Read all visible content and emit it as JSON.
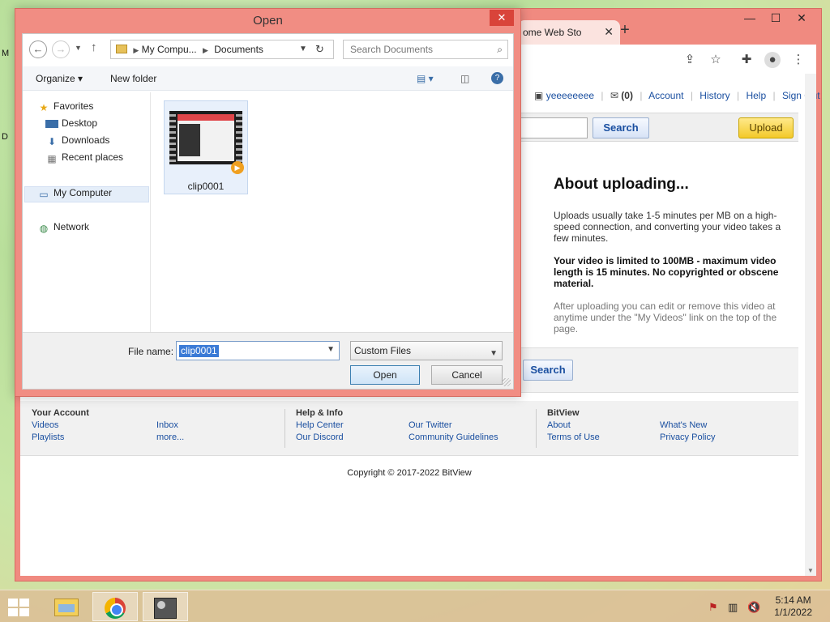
{
  "desktop": {
    "edge_letter_1": "M",
    "edge_letter_2": "D"
  },
  "browser": {
    "tab_title": "ome Web Sto",
    "tab_close": "✕",
    "new_tab": "+",
    "window_controls": {
      "minimize": "—",
      "maximize": "☐",
      "close": "✕"
    },
    "toolbar_icons": [
      "share-icon",
      "star-icon",
      "extensions-icon",
      "profile-icon",
      "menu-icon"
    ]
  },
  "page": {
    "userbar": {
      "username": "yeeeeeeee",
      "inbox_count": "(0)",
      "links": [
        "Account",
        "History",
        "Help",
        "Sign Out"
      ]
    },
    "search_button": "Search",
    "upload_button": "Upload",
    "about": {
      "title": "About uploading...",
      "p1": "Uploads usually take 1-5 minutes per MB on a high-speed connection, and converting your video takes a few minutes.",
      "p2": "Your video is limited to 100MB - maximum video length is 15 minutes. No copyrighted or obscene material.",
      "p3": "After uploading you can edit or remove this video at anytime under the \"My Videos\" link on the top of the page."
    },
    "lower_search_button": "Search",
    "footer": {
      "your_account": {
        "heading": "Your Account",
        "col1": [
          "Videos",
          "Playlists"
        ],
        "col2": [
          "Inbox",
          "more..."
        ]
      },
      "help_info": {
        "heading": "Help & Info",
        "col1": [
          "Help Center",
          "Our Discord"
        ],
        "col2": [
          "Our Twitter",
          "Community Guidelines"
        ]
      },
      "bitview": {
        "heading": "BitView",
        "col1": [
          "About",
          "Terms of Use"
        ],
        "col2": [
          "What's New",
          "Privacy Policy"
        ]
      }
    },
    "copyright": "Copyright © 2017-2022 BitView"
  },
  "dialog": {
    "title": "Open",
    "close": "✕",
    "breadcrumb": {
      "root": "My Compu...",
      "current": "Documents"
    },
    "search_placeholder": "Search Documents",
    "organize": "Organize",
    "new_folder": "New folder",
    "nav": {
      "favorites": "Favorites",
      "desktop": "Desktop",
      "downloads": "Downloads",
      "recent": "Recent places",
      "my_computer": "My Computer",
      "network": "Network"
    },
    "file": {
      "name": "clip0001"
    },
    "file_name_label": "File name:",
    "file_name_value": "clip0001",
    "file_type": "Custom Files",
    "open_button": "Open",
    "cancel_button": "Cancel"
  },
  "taskbar": {
    "time": "5:14 AM",
    "date": "1/1/2022"
  }
}
